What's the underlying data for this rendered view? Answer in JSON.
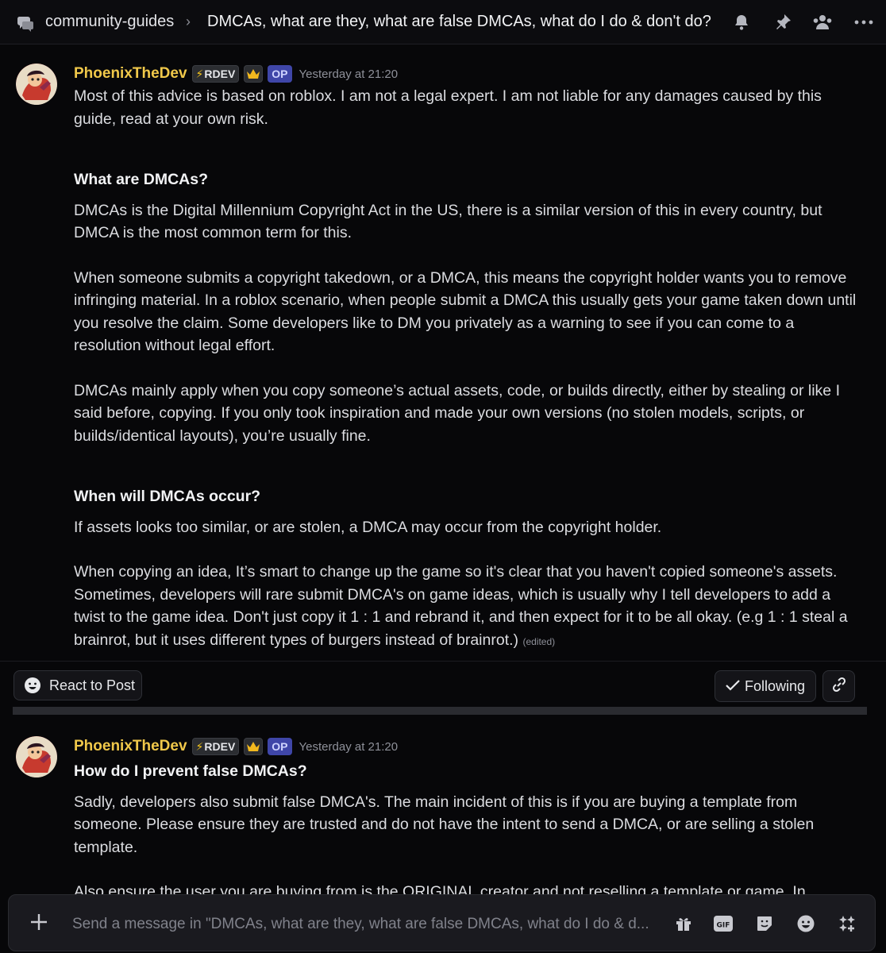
{
  "header": {
    "channel_name": "community-guides",
    "thread_title": "DMCAs, what are they, what are false DMCAs, what do I do & don't do?",
    "icons": [
      "forum-icon",
      "bell-icon",
      "pin-icon",
      "members-icon",
      "more-icon"
    ]
  },
  "post1": {
    "username": "PhoenixTheDev",
    "tag_rdev": "RDEV",
    "tag_op": "OP",
    "timestamp": "Yesterday at 21:20",
    "p1": "Most of this advice is based on roblox. I am not a legal expert. I am not liable for any damages caused by this guide, read at your own risk.",
    "h1": "What are DMCAs?",
    "p2": "DMCAs is the Digital Millennium Copyright Act in the US, there is a similar version of this in every country, but DMCA is the most common term for this.",
    "p3": "When someone submits a copyright takedown, or a DMCA, this means the copyright holder wants you to remove infringing material. In a roblox scenario, when people submit a DMCA this usually gets your game taken down until you resolve the claim. Some developers like to DM you privately as a warning to see if you can come to a resolution without legal effort.",
    "p4": "DMCAs mainly apply when you copy someone’s actual assets, code, or builds directly, either by stealing or like I said before, copying. If you only took inspiration and made your own versions (no stolen models, scripts, or builds/identical layouts), you’re usually fine.",
    "h2": "When will DMCAs occur?",
    "p5": "If assets looks too similar, or are stolen, a DMCA may occur from the copyright holder.",
    "p6": "When copying an idea, It’s smart to change up the game so it's clear that you haven't copied someone's assets. Sometimes, developers will rare submit DMCA's on game ideas, which is usually why I tell developers to add a twist to the game idea. Don't just copy it 1 : 1 and rebrand it, and then expect for it to be all okay. (e.g 1 : 1 steal a brainrot, but it uses different types of burgers instead of brainrot.)",
    "edited": "(edited)"
  },
  "post_actions": {
    "react_label": "React to Post",
    "following_label": "Following"
  },
  "post2": {
    "username": "PhoenixTheDev",
    "tag_rdev": "RDEV",
    "tag_op": "OP",
    "timestamp": "Yesterday at 21:20",
    "h1": "How do I prevent false DMCAs?",
    "p1": "Sadly, developers also submit false DMCA's. The main incident of this is if you are buying a template from someone. Please ensure they are trusted and do not have the intent to send a DMCA, or are selling a stolen template.",
    "p2_partial": "Also ensure the user you are buying from is the ORIGINAL creator and not reselling a template or game. In"
  },
  "composer": {
    "placeholder": "Send a message in \"DMCAs, what are they, what are false DMCAs, what do I do & d...",
    "icons": [
      "gift-icon",
      "gif-icon",
      "sticker-icon",
      "emoji-icon",
      "apps-icon"
    ],
    "gif_label": "GIF"
  },
  "colors": {
    "background": "#070709",
    "username": "#f0c84a",
    "op_badge": "#3f46a8"
  }
}
